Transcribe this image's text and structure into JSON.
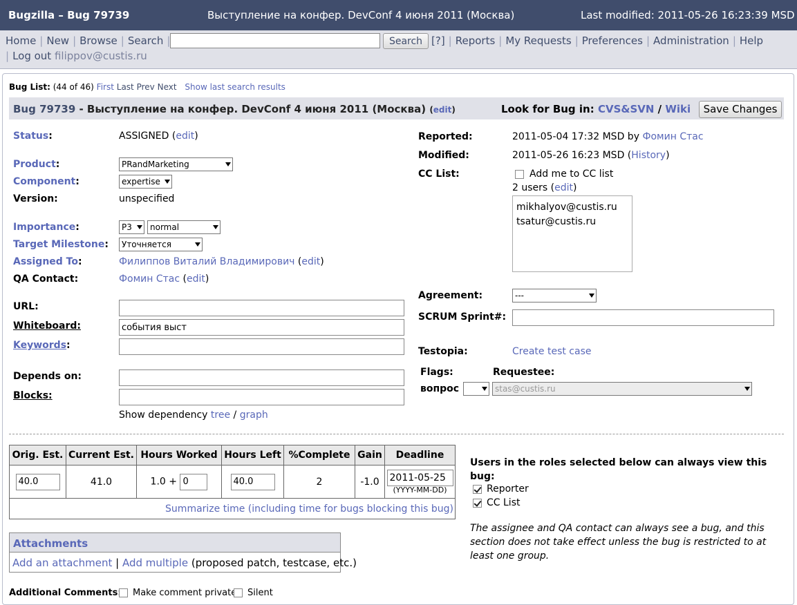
{
  "header": {
    "app": "Bugzilla – Bug 79739",
    "subtitle": "Выступление на конфер. DevConf 4 июня 2011 (Москва)",
    "modified": "Last modified: 2011-05-26 16:23:39 MSD"
  },
  "nav": {
    "home": "Home",
    "new": "New",
    "browse": "Browse",
    "search": "Search",
    "search_btn": "Search",
    "help_q": "[?]",
    "reports": "Reports",
    "my_requests": "My Requests",
    "preferences": "Preferences",
    "administration": "Administration",
    "help": "Help",
    "logout": "Log out",
    "user": "filippov@custis.ru"
  },
  "buglist": {
    "label": "Bug List:",
    "count": "(44 of 46)",
    "first": "First",
    "last": "Last",
    "prev": "Prev",
    "next": "Next",
    "show_last": "Show last search results"
  },
  "title": {
    "bug_link": "Bug 79739",
    "text": " - Выступление на конфер. DevConf 4 июня 2011 (Москва)",
    "edit": "edit",
    "look_for": "Look for Bug in:",
    "cvs": "CVS&SVN",
    "slash": "/",
    "wiki": "Wiki",
    "save": "Save Changes"
  },
  "left": {
    "status_label": "Status",
    "status_value": "ASSIGNED",
    "edit": "edit",
    "product_label": "Product",
    "product_value": "PRandMarketing",
    "component_label": "Component",
    "component_value": "expertise",
    "version_label": "Version:",
    "version_value": "unspecified",
    "importance_label": "Importance",
    "priority": "P3",
    "severity": "normal",
    "milestone_label": "Target Milestone",
    "milestone_value": "Уточняется",
    "assigned_label": "Assigned To",
    "assigned_value": "Филиппов Виталий Владимирович",
    "qa_label": "QA Contact:",
    "qa_value": "Фомин Стас",
    "url_label": "URL:",
    "whiteboard_label": "Whiteboard:",
    "whiteboard_value": "события выст",
    "keywords_label": "Keywords",
    "depends_label": "Depends on:",
    "blocks_label": "Blocks:",
    "show_dep": "Show dependency",
    "tree": "tree",
    "graph": "graph"
  },
  "right": {
    "reported_label": "Reported:",
    "reported_value": "2011-05-04 17:32 MSD by",
    "reporter": "Фомин Стас",
    "modified_label": "Modified:",
    "modified_value": "2011-05-26 16:23 MSD",
    "history": "History",
    "cc_label": "CC List:",
    "add_me": "Add me to CC list",
    "users": "2 users",
    "cc_users": [
      "mikhalyov@custis.ru",
      "tsatur@custis.ru"
    ],
    "agreement_label": "Agreement:",
    "agreement_value": "---",
    "scrum_label": "SCRUM Sprint#:",
    "testopia_label": "Testopia:",
    "create_test": "Create test case",
    "flags_label": "Flags:",
    "requestee_label": "Requestee:",
    "flag_name": "вопрос",
    "requestee_value": "stas@custis.ru"
  },
  "time": {
    "headers": [
      "Orig. Est.",
      "Current Est.",
      "Hours Worked",
      "Hours Left",
      "%Complete",
      "Gain",
      "Deadline"
    ],
    "orig": "40.0",
    "current": "41.0",
    "worked": "1.0 +",
    "worked_add": "0",
    "left": "40.0",
    "complete": "2",
    "gain": "-1.0",
    "deadline": "2011-05-25",
    "deadline_fmt": "(YYYY-MM-DD)",
    "summarize": "Summarize time (including time for bugs blocking this bug)"
  },
  "roles": {
    "intro": "Users in the roles selected below can always view this bug:",
    "reporter": "Reporter",
    "cc": "CC List",
    "note": "The assignee and QA contact can always see a bug, and this section does not take effect unless the bug is restricted to at least one group."
  },
  "attachments": {
    "title": "Attachments",
    "add": "Add an attachment",
    "add_multiple": "Add multiple",
    "hint": "(proposed patch, testcase, etc.)"
  },
  "comments": {
    "label": "Additional Comments:",
    "private": "Make comment private",
    "silent": "Silent"
  }
}
